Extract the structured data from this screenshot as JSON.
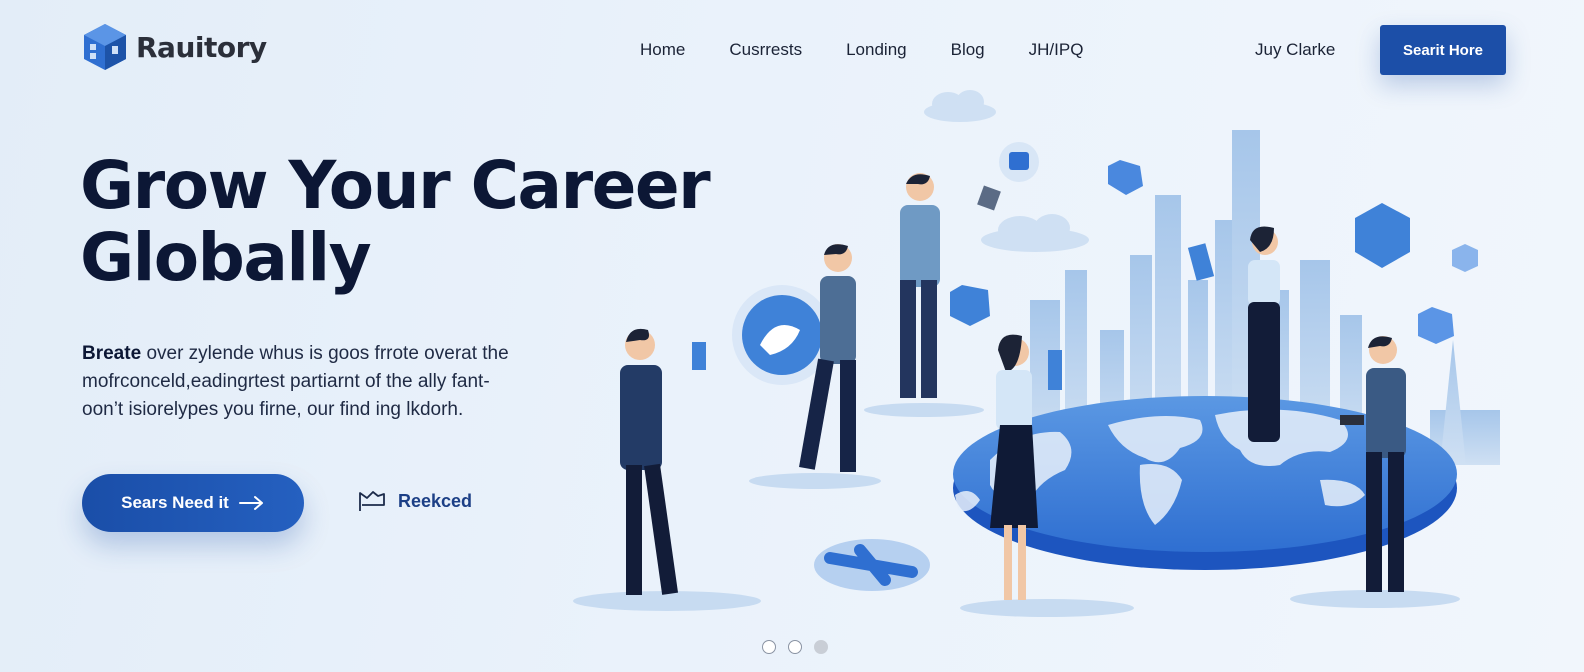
{
  "brand": {
    "name": "Rauitory",
    "logo_icon": "cube-logo-icon"
  },
  "nav": {
    "items": [
      "Home",
      "Cusrrests",
      "Londing",
      "Blog",
      "JH/IPQ"
    ]
  },
  "header": {
    "user_name": "Juy Clarke",
    "search_button": "Searit Hore"
  },
  "hero": {
    "title_line1": "Grow Your Career",
    "title_line2": "Globally",
    "desc_lead": "Breate",
    "desc_rest": "over zylende whus is goos frrote overat the",
    "desc_line2": "mofrconceld,eadingrtest partiarnt of the ally fant-",
    "desc_line3": "oon’t isiorelypes you firne, our find ing lkdorh.",
    "cta_label": "Sears Need it",
    "cta_icon": "arrow-right-icon",
    "secondary_label": "Reekced",
    "secondary_icon": "flag-icon"
  },
  "carousel": {
    "count": 3,
    "active_index": 2
  },
  "colors": {
    "accent": "#1c4fa8",
    "headline": "#0c1735",
    "background": "#e6eff9"
  }
}
